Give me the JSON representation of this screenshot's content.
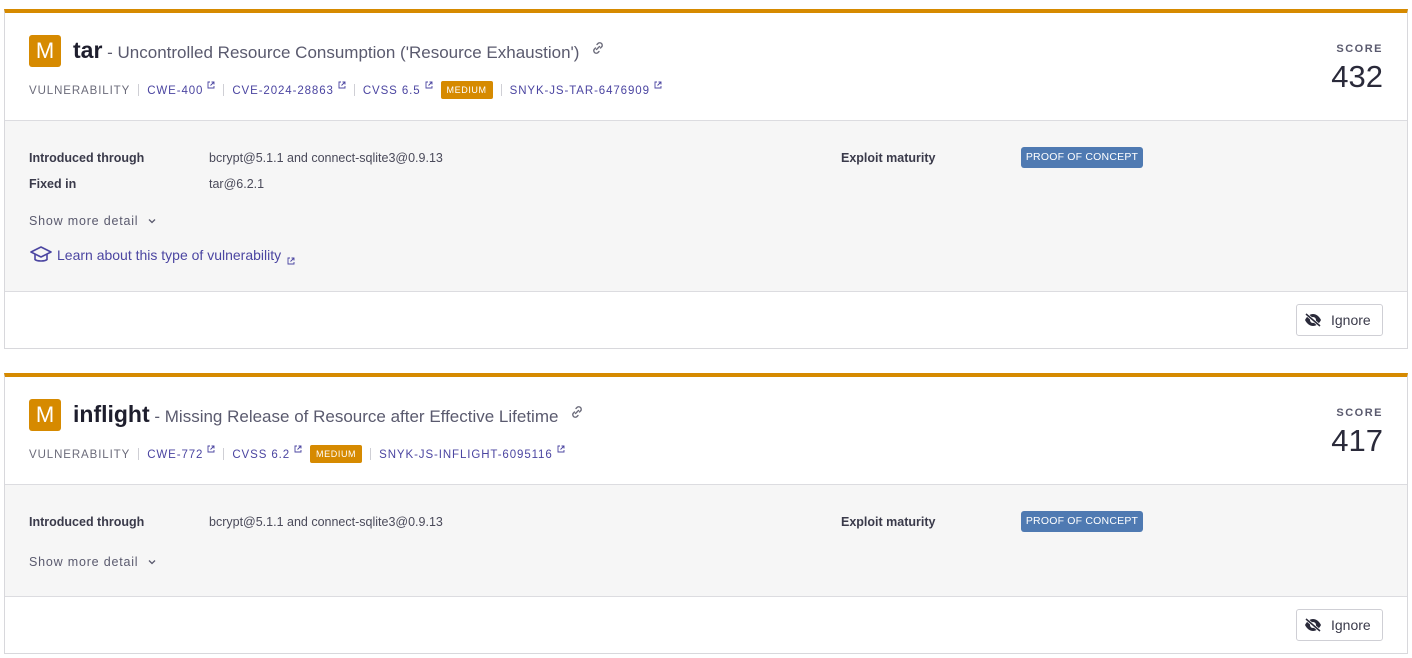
{
  "issues": [
    {
      "severity_letter": "M",
      "package": "tar",
      "separator": " - ",
      "title": "Uncontrolled Resource Consumption ('Resource Exhaustion')",
      "type": "VULNERABILITY",
      "cwe": "CWE-400",
      "cve": "CVE-2024-28863",
      "cvss": "CVSS 6.5",
      "severity_label": "MEDIUM",
      "snyk_id": "SNYK-JS-TAR-6476909",
      "score_label": "SCORE",
      "score": "432",
      "introduced_label": "Introduced through",
      "introduced_value": "bcrypt@5.1.1 and connect-sqlite3@0.9.13",
      "fixed_label": "Fixed in",
      "fixed_value": "tar@6.2.1",
      "exploit_label": "Exploit maturity",
      "exploit_value": "PROOF OF CONCEPT",
      "show_more": "Show more detail",
      "learn_link": "Learn about this type of vulnerability",
      "ignore_label": "Ignore"
    },
    {
      "severity_letter": "M",
      "package": "inflight",
      "separator": " - ",
      "title": "Missing Release of Resource after Effective Lifetime",
      "type": "VULNERABILITY",
      "cwe": "CWE-772",
      "cvss": "CVSS 6.2",
      "severity_label": "MEDIUM",
      "snyk_id": "SNYK-JS-INFLIGHT-6095116",
      "score_label": "SCORE",
      "score": "417",
      "introduced_label": "Introduced through",
      "introduced_value": "bcrypt@5.1.1 and connect-sqlite3@0.9.13",
      "exploit_label": "Exploit maturity",
      "exploit_value": "PROOF OF CONCEPT",
      "show_more": "Show more detail",
      "ignore_label": "Ignore"
    }
  ],
  "colors": {
    "severity_medium": "#d68a00",
    "link": "#4b45a1",
    "proof_of_concept": "#4f7ab2"
  },
  "icons": [
    "link-icon",
    "external-link-icon",
    "chevron-down-icon",
    "graduation-cap-icon",
    "eye-off-icon"
  ]
}
